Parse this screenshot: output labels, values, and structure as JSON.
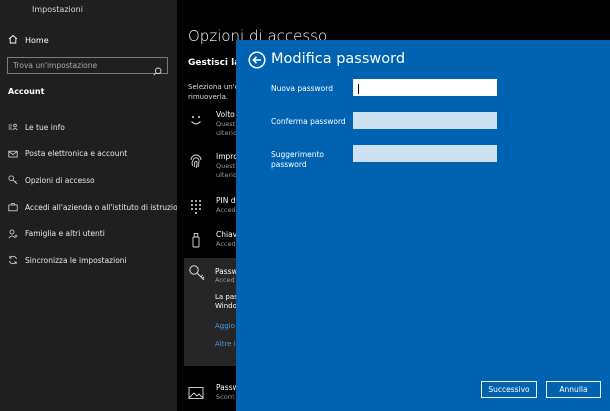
{
  "window": {
    "title": "Impostazioni"
  },
  "sidebar": {
    "home_label": "Home",
    "search_placeholder": "Trova un'impostazione",
    "section_title": "Account",
    "items": [
      {
        "label": "Le tue info",
        "icon": "user-info-icon"
      },
      {
        "label": "Posta elettronica e account",
        "icon": "mail-icon"
      },
      {
        "label": "Opzioni di accesso",
        "icon": "key-icon"
      },
      {
        "label": "Accedi all'azienda o all'istituto di istruzione",
        "icon": "briefcase-icon"
      },
      {
        "label": "Famiglia e altri utenti",
        "icon": "person-add-icon"
      },
      {
        "label": "Sincronizza le impostazioni",
        "icon": "sync-icon"
      }
    ]
  },
  "background": {
    "page_title": "Opzioni di accesso",
    "subhead": "Gestisci la",
    "desc_line1": "Seleziona un'o",
    "desc_line2": "rimuoverla.",
    "options": [
      {
        "title": "Volto d",
        "sub1": "Quest",
        "sub2": "ulterio",
        "icon": "face-icon"
      },
      {
        "title": "Impro",
        "sub1": "Quest",
        "sub2": "ulterio",
        "icon": "fingerprint-icon"
      },
      {
        "title": "PIN d",
        "sub1": "Acced",
        "icon": "pin-keypad-icon"
      },
      {
        "title": "Chiav",
        "sub1": "Acced",
        "icon": "usb-key-icon"
      }
    ],
    "password_panel": {
      "title": "Passw",
      "sub": "Acced",
      "line1": "La pas",
      "line2": "Windo",
      "link1": "Aggio",
      "link2": "Altre in"
    },
    "picture_option": {
      "title": "Passw",
      "sub": "Scorri",
      "icon": "picture-icon"
    }
  },
  "dialog": {
    "title": "Modifica password",
    "fields": {
      "new_password": {
        "label": "Nuova password",
        "value": ""
      },
      "confirm_password": {
        "label": "Conferma password",
        "value": ""
      },
      "hint": {
        "label_line1": "Suggerimento",
        "label_line2": "password",
        "value": ""
      }
    },
    "next_label": "Successivo",
    "cancel_label": "Annulla"
  },
  "colors": {
    "dialog_bg": "#0063b1",
    "sidebar_bg": "#1f1f1f",
    "field_idle": "#cce0f2",
    "link": "#4a9be8"
  }
}
